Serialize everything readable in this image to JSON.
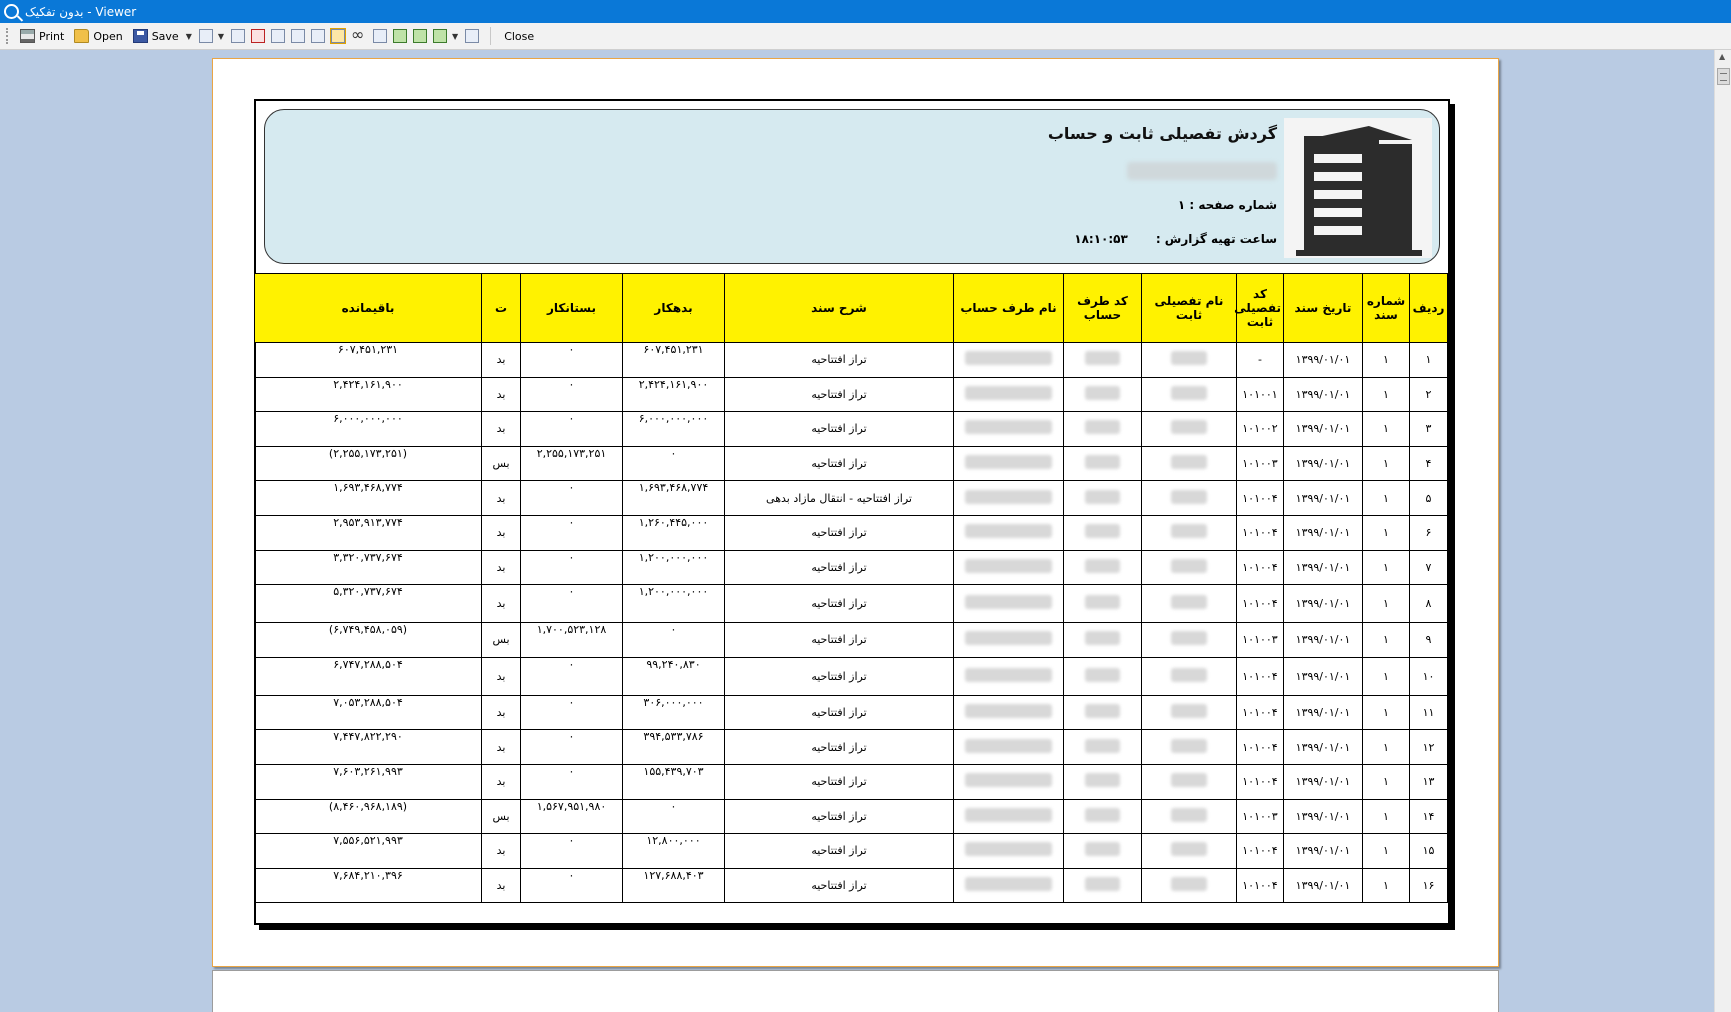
{
  "window": {
    "title": "بدون تفکیک - Viewer"
  },
  "toolbar": {
    "print": "Print",
    "open": "Open",
    "save": "Save",
    "close": "Close"
  },
  "report": {
    "title": "گردش تفصیلی ثابت و حساب",
    "page_label": "شماره صفحه :",
    "page_number": "۱",
    "time_label": "ساعت تهیه گزارش :",
    "time_value": "۱۸:۱۰:۵۳"
  },
  "table": {
    "headers": [
      "ردیف",
      "شماره سند",
      "تاریخ سند",
      "کد تفصیلی ثابت",
      "نام تفصیلی ثابت",
      "کد طرف حساب",
      "نام طرف حساب",
      "شرح سند",
      "بدهکار",
      "بستانکار",
      "ت",
      "باقیمانده"
    ],
    "rows": [
      [
        "۱",
        "۱",
        "۱۳۹۹/۰۱/۰۱",
        "-",
        "",
        "",
        "",
        "تراز افتتاحیه",
        "۶۰۷,۴۵۱,۲۳۱",
        "۰",
        "بد",
        "۶۰۷,۴۵۱,۲۳۱"
      ],
      [
        "۲",
        "۱",
        "۱۳۹۹/۰۱/۰۱",
        "۱۰۱۰۰۱",
        "",
        "",
        "",
        "تراز افتتاحیه",
        "۲,۴۲۴,۱۶۱,۹۰۰",
        "۰",
        "بد",
        "۲,۴۲۴,۱۶۱,۹۰۰"
      ],
      [
        "۳",
        "۱",
        "۱۳۹۹/۰۱/۰۱",
        "۱۰۱۰۰۲",
        "",
        "",
        "",
        "تراز افتتاحیه",
        "۶,۰۰۰,۰۰۰,۰۰۰",
        "۰",
        "بد",
        "۶,۰۰۰,۰۰۰,۰۰۰"
      ],
      [
        "۴",
        "۱",
        "۱۳۹۹/۰۱/۰۱",
        "۱۰۱۰۰۳",
        "",
        "",
        "",
        "تراز افتتاحیه",
        "۰",
        "۲,۲۵۵,۱۷۳,۲۵۱",
        "بس",
        "(۲,۲۵۵,۱۷۳,۲۵۱)"
      ],
      [
        "۵",
        "۱",
        "۱۳۹۹/۰۱/۰۱",
        "۱۰۱۰۰۴",
        "",
        "",
        "",
        "تراز افتتاحیه - انتقال مازاد بدهی",
        "۱,۶۹۳,۴۶۸,۷۷۴",
        "۰",
        "بد",
        "۱,۶۹۳,۴۶۸,۷۷۴"
      ],
      [
        "۶",
        "۱",
        "۱۳۹۹/۰۱/۰۱",
        "۱۰۱۰۰۴",
        "",
        "",
        "",
        "تراز افتتاحیه",
        "۱,۲۶۰,۴۴۵,۰۰۰",
        "۰",
        "بد",
        "۲,۹۵۳,۹۱۳,۷۷۴"
      ],
      [
        "۷",
        "۱",
        "۱۳۹۹/۰۱/۰۱",
        "۱۰۱۰۰۴",
        "",
        "",
        "",
        "تراز افتتاحیه",
        "۱,۲۰۰,۰۰۰,۰۰۰",
        "۰",
        "بد",
        "۳,۳۲۰,۷۳۷,۶۷۴"
      ],
      [
        "۸",
        "۱",
        "۱۳۹۹/۰۱/۰۱",
        "۱۰۱۰۰۴",
        "",
        "",
        "",
        "تراز افتتاحیه",
        "۱,۲۰۰,۰۰۰,۰۰۰",
        "۰",
        "بد",
        "۵,۳۲۰,۷۳۷,۶۷۴"
      ],
      [
        "۹",
        "۱",
        "۱۳۹۹/۰۱/۰۱",
        "۱۰۱۰۰۳",
        "",
        "",
        "",
        "تراز افتتاحیه",
        "۰",
        "۱,۷۰۰,۵۲۳,۱۲۸",
        "بس",
        "(۶,۷۴۹,۴۵۸,۰۵۹)"
      ],
      [
        "۱۰",
        "۱",
        "۱۳۹۹/۰۱/۰۱",
        "۱۰۱۰۰۴",
        "",
        "",
        "",
        "تراز افتتاحیه",
        "۹۹,۲۴۰,۸۳۰",
        "۰",
        "بد",
        "۶,۷۴۷,۲۸۸,۵۰۴"
      ],
      [
        "۱۱",
        "۱",
        "۱۳۹۹/۰۱/۰۱",
        "۱۰۱۰۰۴",
        "",
        "",
        "",
        "تراز افتتاحیه",
        "۳۰۶,۰۰۰,۰۰۰",
        "۰",
        "بد",
        "۷,۰۵۳,۲۸۸,۵۰۴"
      ],
      [
        "۱۲",
        "۱",
        "۱۳۹۹/۰۱/۰۱",
        "۱۰۱۰۰۴",
        "",
        "",
        "",
        "تراز افتتاحیه",
        "۳۹۴,۵۳۳,۷۸۶",
        "۰",
        "بد",
        "۷,۴۴۷,۸۲۲,۲۹۰"
      ],
      [
        "۱۳",
        "۱",
        "۱۳۹۹/۰۱/۰۱",
        "۱۰۱۰۰۴",
        "",
        "",
        "",
        "تراز افتتاحیه",
        "۱۵۵,۴۳۹,۷۰۳",
        "۰",
        "بد",
        "۷,۶۰۳,۲۶۱,۹۹۳"
      ],
      [
        "۱۴",
        "۱",
        "۱۳۹۹/۰۱/۰۱",
        "۱۰۱۰۰۳",
        "",
        "",
        "",
        "تراز افتتاحیه",
        "۰",
        "۱,۵۶۷,۹۵۱,۹۸۰",
        "بس",
        "(۸,۴۶۰,۹۶۸,۱۸۹)"
      ],
      [
        "۱۵",
        "۱",
        "۱۳۹۹/۰۱/۰۱",
        "۱۰۱۰۰۴",
        "",
        "",
        "",
        "تراز افتتاحیه",
        "۱۲,۸۰۰,۰۰۰",
        "۰",
        "بد",
        "۷,۵۵۶,۵۲۱,۹۹۳"
      ],
      [
        "۱۶",
        "۱",
        "۱۳۹۹/۰۱/۰۱",
        "۱۰۱۰۰۴",
        "",
        "",
        "",
        "تراز افتتاحیه",
        "۱۲۷,۶۸۸,۴۰۳",
        "۰",
        "بد",
        "۷,۶۸۴,۲۱۰,۳۹۶"
      ]
    ]
  },
  "colors": {
    "titlebar": "#0a78d7",
    "header_fill": "#fff200",
    "report_header": "#d6eaf0",
    "workspace": "#b9cbe3"
  },
  "icons": [
    "print-icon",
    "open-folder-icon",
    "save-disk-icon",
    "find-binoculars-icon"
  ]
}
